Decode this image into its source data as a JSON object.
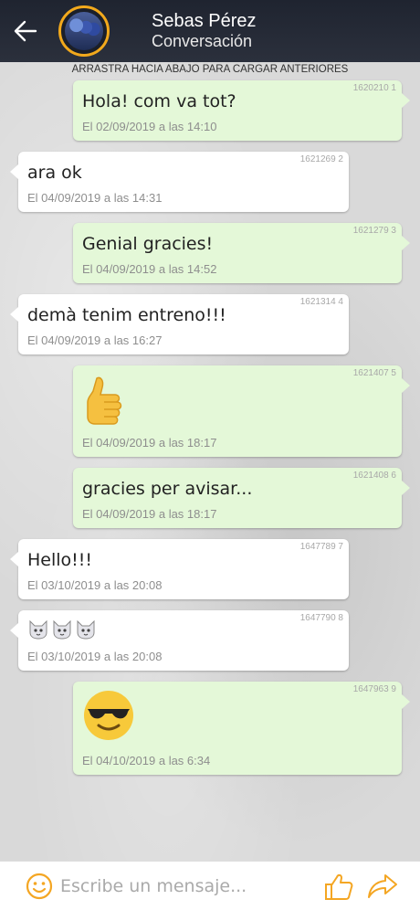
{
  "header": {
    "name": "Sebas Pérez",
    "subtitle": "Conversación"
  },
  "chat": {
    "load_hint": "ARRASTRA HACIA ABAJO PARA CARGAR ANTERIORES",
    "messages": [
      {
        "id": "1620210 1",
        "direction": "sent",
        "text": "Hola! com va tot?",
        "date": "El 02/09/2019 a las 14:10"
      },
      {
        "id": "1621269 2",
        "direction": "received",
        "text": "ara ok",
        "date": "El 04/09/2019 a las 14:31"
      },
      {
        "id": "1621279 3",
        "direction": "sent",
        "text": "Genial gracies!",
        "date": "El 04/09/2019 a las 14:52"
      },
      {
        "id": "1621314 4",
        "direction": "received",
        "text": "demà tenim entreno!!!",
        "date": "El 04/09/2019 a las 16:27"
      },
      {
        "id": "1621407 5",
        "direction": "sent",
        "emoji": "thumbs-up-emoji",
        "date": "El 04/09/2019 a las 18:17"
      },
      {
        "id": "1621408 6",
        "direction": "sent",
        "text": "gracies per avisar...",
        "date": "El 04/09/2019 a las 18:17"
      },
      {
        "id": "1647789 7",
        "direction": "received",
        "text": "Hello!!!",
        "date": "El 03/10/2019 a las 20:08"
      },
      {
        "id": "1647790 8",
        "direction": "received",
        "emoji": "cat-face-emoji x3",
        "date": "El 03/10/2019 a las 20:08"
      },
      {
        "id": "1647963 9",
        "direction": "sent",
        "emoji": "sunglasses-emoji",
        "date": "El 04/10/2019 a las 6:34"
      }
    ]
  },
  "composer": {
    "placeholder": "Escribe un mensaje..."
  },
  "colors": {
    "header_bg": "#2b303c",
    "avatar_ring": "#f2a91c",
    "sent_bubble": "#e4f8d8",
    "received_bubble": "#ffffff",
    "icon_orange": "#f4a623"
  },
  "icons": [
    "back-arrow-icon",
    "smiley-icon",
    "thumbs-up-icon",
    "share-arrow-icon"
  ]
}
